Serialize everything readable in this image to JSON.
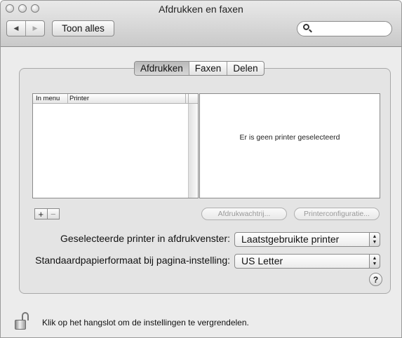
{
  "window": {
    "title": "Afdrukken en faxen"
  },
  "toolbar": {
    "back_icon": "back-arrow",
    "forward_icon": "forward-arrow",
    "show_all_label": "Toon alles",
    "search": {
      "value": "",
      "placeholder": ""
    }
  },
  "tabs": [
    {
      "label": "Afdrukken",
      "selected": true
    },
    {
      "label": "Faxen",
      "selected": false
    },
    {
      "label": "Delen",
      "selected": false
    }
  ],
  "printer_list": {
    "columns": [
      "In menu",
      "Printer"
    ],
    "rows": []
  },
  "detail": {
    "empty_message": "Er is geen printer geselecteerd"
  },
  "list_controls": {
    "add": "+",
    "remove": "−"
  },
  "buttons": {
    "print_queue": "Afdrukwachtrij...",
    "printer_setup": "Printerconfiguratie..."
  },
  "settings": {
    "selected_printer_label": "Geselecteerde printer in afdrukvenster:",
    "selected_printer_value": "Laatstgebruikte printer",
    "paper_size_label": "Standaardpapierformaat bij pagina-instelling:",
    "paper_size_value": "US Letter"
  },
  "help_label": "?",
  "lock_message": "Klik op het hangslot om de instellingen te vergrendelen."
}
